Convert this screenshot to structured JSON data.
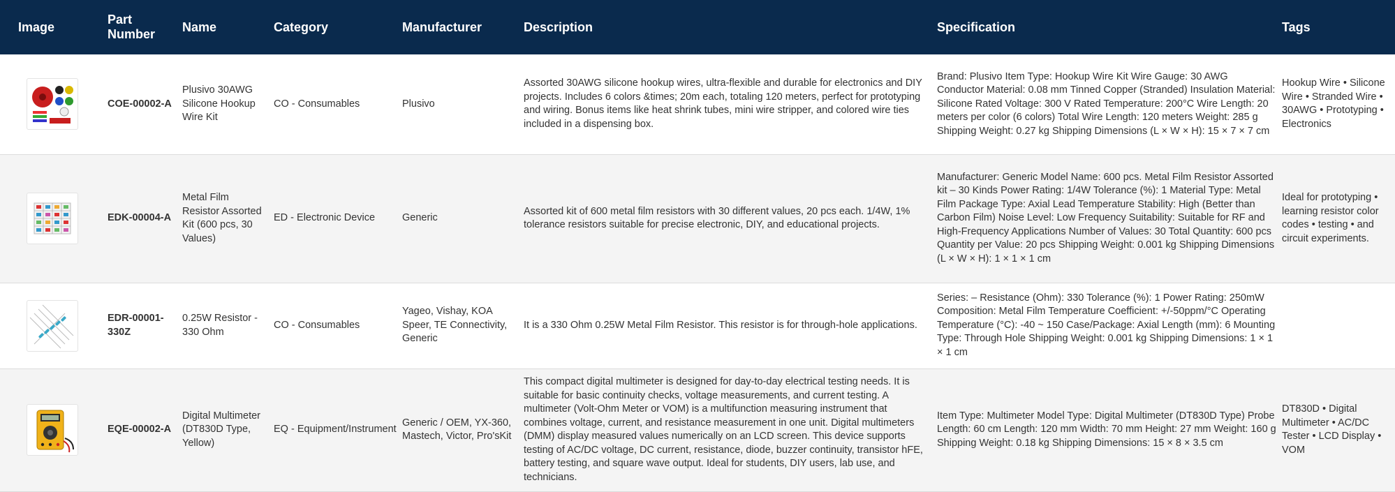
{
  "table": {
    "headers": [
      "Image",
      "Part Number",
      "Name",
      "Category",
      "Manufacturer",
      "Description",
      "Specification",
      "Tags"
    ],
    "rows": [
      {
        "image_icon": "wire-kit-icon",
        "part_number": "COE-00002-A",
        "name": "Plusivo 30AWG Silicone Hookup Wire Kit",
        "category": "CO - Consumables",
        "manufacturer": "Plusivo",
        "description": "Assorted 30AWG silicone hookup wires, ultra-flexible and durable for electronics and DIY projects. Includes 6 colors &times; 20m each, totaling 120 meters, perfect for prototyping and wiring. Bonus items like heat shrink tubes, mini wire stripper, and colored wire ties included in a dispensing box.",
        "specification": "Brand: Plusivo Item Type: Hookup Wire Kit Wire Gauge: 30 AWG Conductor Material: 0.08 mm Tinned Copper (Stranded) Insulation Material: Silicone Rated Voltage: 300 V Rated Temperature: 200°C Wire Length: 20 meters per color (6 colors) Total Wire Length: 120 meters Weight: 285 g Shipping Weight: 0.27 kg Shipping Dimensions (L × W × H): 15 × 7 × 7 cm",
        "tags": "Hookup Wire • Silicone Wire • Stranded Wire • 30AWG • Prototyping • Electronics"
      },
      {
        "image_icon": "resistor-kit-box-icon",
        "part_number": "EDK-00004-A",
        "name": "Metal Film Resistor Assorted Kit (600 pcs, 30 Values)",
        "category": "ED - Electronic Device",
        "manufacturer": "Generic",
        "description": "Assorted kit of 600 metal film resistors with 30 different values, 20 pcs each. 1/4W, 1% tolerance resistors suitable for precise electronic, DIY, and educational projects.",
        "specification": "Manufacturer: Generic Model Name: 600 pcs. Metal Film Resistor Assorted kit – 30 Kinds Power Rating: 1/4W Tolerance (%): 1 Material Type: Metal Film Package Type: Axial Lead Temperature Stability: High (Better than Carbon Film) Noise Level: Low Frequency Suitability: Suitable for RF and High-Frequency Applications Number of Values: 30 Total Quantity: 600 pcs Quantity per Value: 20 pcs Shipping Weight: 0.001 kg Shipping Dimensions (L × W × H): 1 × 1 × 1 cm",
        "tags": "Ideal for prototyping • learning resistor color codes • testing • and circuit experiments."
      },
      {
        "image_icon": "resistors-icon",
        "part_number": "EDR-00001-330Z",
        "name": "0.25W Resistor - 330 Ohm",
        "category": "CO - Consumables",
        "manufacturer": "Yageo, Vishay, KOA Speer, TE Connectivity, Generic",
        "description": "It is a 330 Ohm 0.25W Metal Film Resistor. This resistor is for through-hole applications.",
        "specification": "Series: – Resistance (Ohm): 330 Tolerance (%): 1 Power Rating: 250mW Composition: Metal Film Temperature Coefficient: +/-50ppm/°C Operating Temperature (°C): -40 ~ 150 Case/Package: Axial Length (mm): 6 Mounting Type: Through Hole Shipping Weight: 0.001 kg Shipping Dimensions: 1 × 1 × 1 cm",
        "tags": ""
      },
      {
        "image_icon": "multimeter-icon",
        "part_number": "EQE-00002-A",
        "name": "Digital Multimeter (DT830D Type, Yellow)",
        "category": "EQ - Equipment/Instrument",
        "manufacturer": "Generic / OEM, YX-360, Mastech, Victor, Pro'sKit",
        "description": "This compact digital multimeter is designed for day-to-day electrical testing needs. It is suitable for basic continuity checks, voltage measurements, and current testing. A multimeter (Volt-Ohm Meter or VOM) is a multifunction measuring instrument that combines voltage, current, and resistance measurement in one unit. Digital multimeters (DMM) display measured values numerically on an LCD screen. This device supports testing of AC/DC voltage, DC current, resistance, diode, buzzer continuity, transistor hFE, battery testing, and square wave output. Ideal for students, DIY users, lab use, and technicians.",
        "specification": "Item Type: Multimeter Model Type: Digital Multimeter (DT830D Type) Probe Length: 60 cm Length: 120 mm Width: 70 mm Height: 27 mm Weight: 160 g Shipping Weight: 0.18 kg Shipping Dimensions: 15 × 8 × 3.5 cm",
        "tags": "DT830D • Digital Multimeter • AC/DC Tester • LCD Display • VOM"
      }
    ]
  },
  "colors": {
    "header_bg": "#0a2a4d",
    "header_text": "#ffffff",
    "row_alt_bg": "#f4f4f4",
    "border": "#dcdcdc"
  }
}
